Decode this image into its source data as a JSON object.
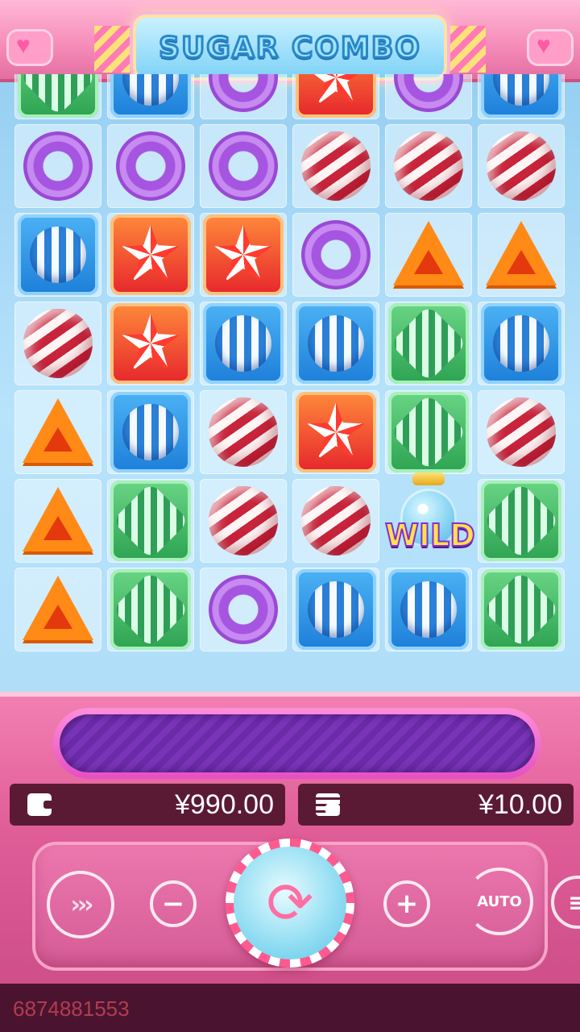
{
  "game": {
    "title": "SUGAR COMBO",
    "wild_label": "WILD"
  },
  "board": {
    "rows": [
      [
        "wrap-green",
        "wrap-blue",
        "donut",
        "wrap-red",
        "donut",
        "wrap-blue"
      ],
      [
        "donut",
        "donut",
        "donut",
        "ball",
        "ball",
        "ball"
      ],
      [
        "wrap-blue",
        "wrap-red",
        "wrap-red",
        "donut",
        "triangle",
        "triangle"
      ],
      [
        "ball",
        "wrap-red",
        "wrap-blue",
        "wrap-blue",
        "wrap-green",
        "wrap-blue"
      ],
      [
        "triangle",
        "wrap-blue",
        "ball",
        "wrap-red",
        "wrap-green",
        "ball"
      ],
      [
        "triangle",
        "wrap-green",
        "ball",
        "ball",
        "wild",
        "wrap-green"
      ],
      [
        "triangle",
        "wrap-green",
        "donut",
        "wrap-blue",
        "wrap-blue",
        "wrap-green"
      ]
    ]
  },
  "balance": {
    "icon": "wallet-icon",
    "value": "¥990.00"
  },
  "bet": {
    "icon": "coins-icon",
    "value": "¥10.00"
  },
  "controls": {
    "turbo_label": "›››",
    "minus_label": "−",
    "plus_label": "+",
    "auto_label": "AUTO",
    "menu_label": "≡",
    "spin_label": "⟳"
  },
  "footer": {
    "id": "6874881553"
  },
  "colors": {
    "header_pink": "#f58ab8",
    "panel_pink": "#e05d98",
    "info_box": "#5b1a34",
    "footer_id": "#b33c50"
  }
}
